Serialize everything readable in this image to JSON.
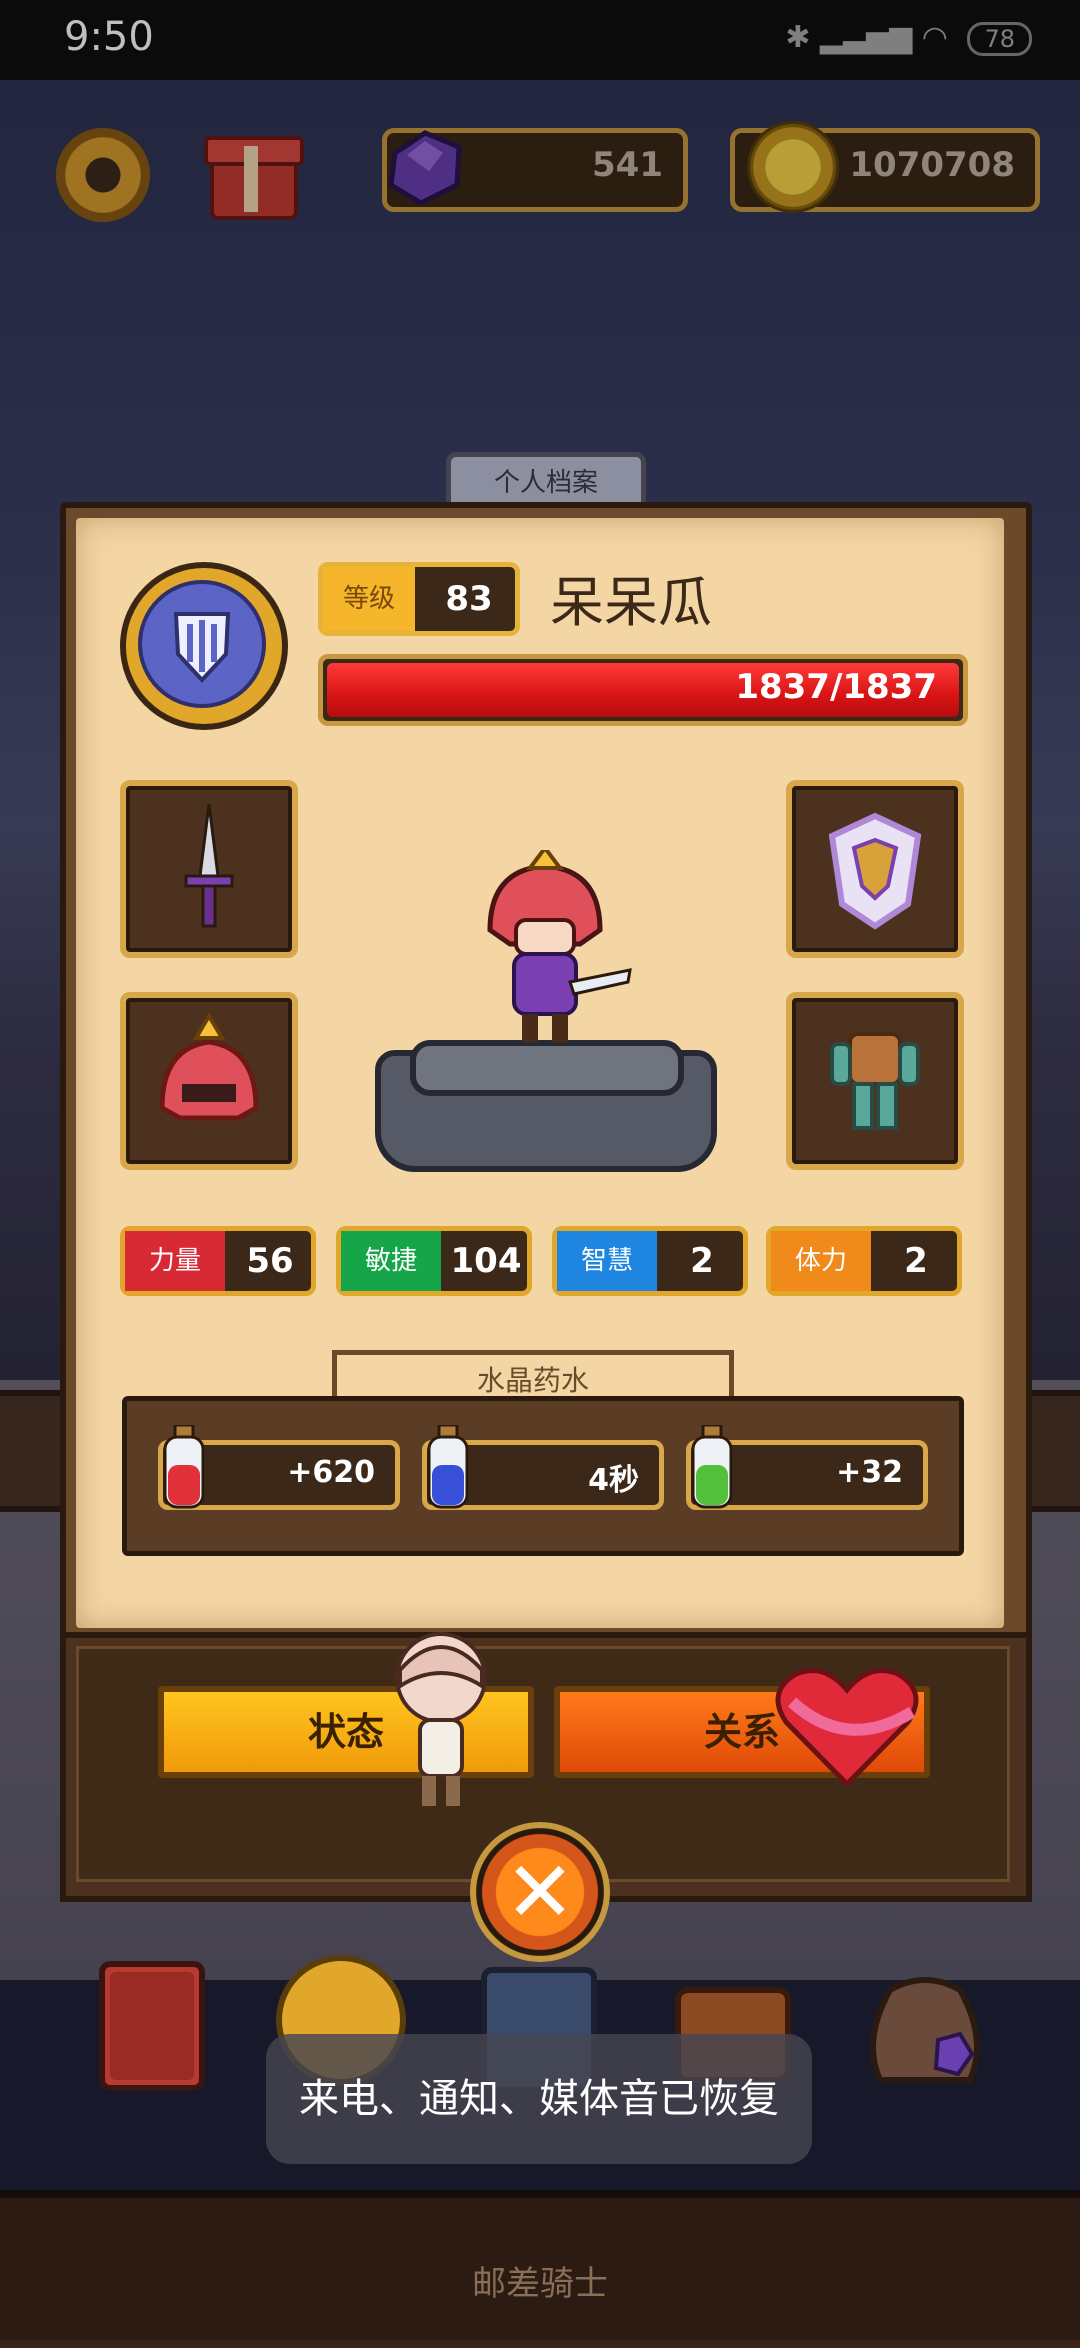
{
  "status_bar": {
    "time": "9:50",
    "battery": "78"
  },
  "hud": {
    "gems": "541",
    "coins": "1070708",
    "icons": [
      "gear-icon",
      "gift-icon",
      "gem-icon",
      "coin-icon"
    ]
  },
  "profile": {
    "tab_title": "个人档案",
    "level_label": "等级",
    "level": "83",
    "name": "呆呆瓜",
    "hp_text": "1837/1837",
    "hp_fraction": 1.0,
    "stats": [
      {
        "label": "力量",
        "value": "56",
        "color": "#d72a34"
      },
      {
        "label": "敏捷",
        "value": "104",
        "color": "#17a54a"
      },
      {
        "label": "智慧",
        "value": "2",
        "color": "#1e86e0"
      },
      {
        "label": "体力",
        "value": "2",
        "color": "#f08a1a"
      }
    ],
    "equipment": [
      "sword-icon",
      "armor-icon",
      "helmet-icon",
      "outfit-icon"
    ]
  },
  "potions": {
    "title": "水晶药水",
    "items": [
      {
        "value": "+620",
        "color": "#e0303a"
      },
      {
        "value": "4秒",
        "color": "#3850d8"
      },
      {
        "value": "+32",
        "color": "#52c03a"
      }
    ]
  },
  "buttons": {
    "state": "状态",
    "relation": "关系"
  },
  "toast": "来电、通知、媒体音已恢复",
  "footer": "邮差骑士"
}
